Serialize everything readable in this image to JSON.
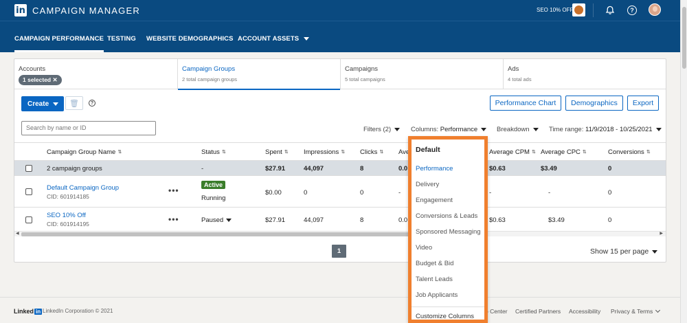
{
  "header": {
    "logo": "in",
    "title": "CAMPAIGN MANAGER",
    "account_name": "SEO 10% OFF"
  },
  "nav": {
    "items": [
      "CAMPAIGN PERFORMANCE",
      "TESTING",
      "WEBSITE DEMOGRAPHICS",
      "ACCOUNT ASSETS"
    ]
  },
  "tabs": [
    {
      "title": "Accounts",
      "sub": "1 selected ✕"
    },
    {
      "title": "Campaign Groups",
      "sub": "2 total campaign groups"
    },
    {
      "title": "Campaigns",
      "sub": "5 total campaigns"
    },
    {
      "title": "Ads",
      "sub": "4 total ads"
    }
  ],
  "toolbar": {
    "create_label": "Create",
    "trash_icon": "🗑",
    "help_icon": "?",
    "performance_chart": "Performance Chart",
    "demographics": "Demographics",
    "export": "Export"
  },
  "search": {
    "placeholder": "Search by name or ID"
  },
  "filters": {
    "filters_label": "Filters (2)",
    "columns_label": "Columns:",
    "columns_value": "Performance",
    "breakdown_label": "Breakdown",
    "time_label": "Time range:",
    "time_value": "11/9/2018 - 10/25/2021"
  },
  "table": {
    "headers": [
      "Campaign Group Name",
      "Status",
      "Spent",
      "Impressions",
      "Clicks",
      "Ave",
      "Average CPM",
      "Average CPC",
      "Conversions"
    ],
    "total": {
      "name": "2 campaign groups",
      "status": "-",
      "spent": "$27.91",
      "impressions": "44,097",
      "clicks": "8",
      "ave": "0.0",
      "cpm": "$0.63",
      "cpc": "$3.49",
      "conversions": "0"
    },
    "rows": [
      {
        "name": "Default Campaign Group",
        "cid": "CID: 601914185",
        "badge": "Active",
        "status": "Running",
        "spent": "$0.00",
        "impressions": "0",
        "clicks": "0",
        "ave": "-",
        "cpm": "-",
        "cpc": "-",
        "conversions": "0"
      },
      {
        "name": "SEO 10% Off",
        "cid": "CID: 601914195",
        "badge": "",
        "status": "Paused",
        "spent": "$27.91",
        "impressions": "44,097",
        "clicks": "8",
        "ave": "0.0",
        "cpm": "$0.63",
        "cpc": "$3.49",
        "conversions": "0"
      }
    ],
    "dots": "•••"
  },
  "pagination": {
    "page": "1",
    "per_page": "Show 15 per page"
  },
  "dropdown": {
    "header": "Default",
    "items": [
      "Performance",
      "Delivery",
      "Engagement",
      "Conversions & Leads",
      "Sponsored Messaging",
      "Video",
      "Budget & Bid",
      "Talent Leads",
      "Job Applicants"
    ],
    "customize": "Customize Columns"
  },
  "footer": {
    "logo_text": "Linked",
    "logo_in": "in",
    "copyright": "LinkedIn Corporation © 2021",
    "links": [
      "o Center",
      "Certified Partners",
      "Accessibility",
      "Privacy & Terms"
    ]
  }
}
